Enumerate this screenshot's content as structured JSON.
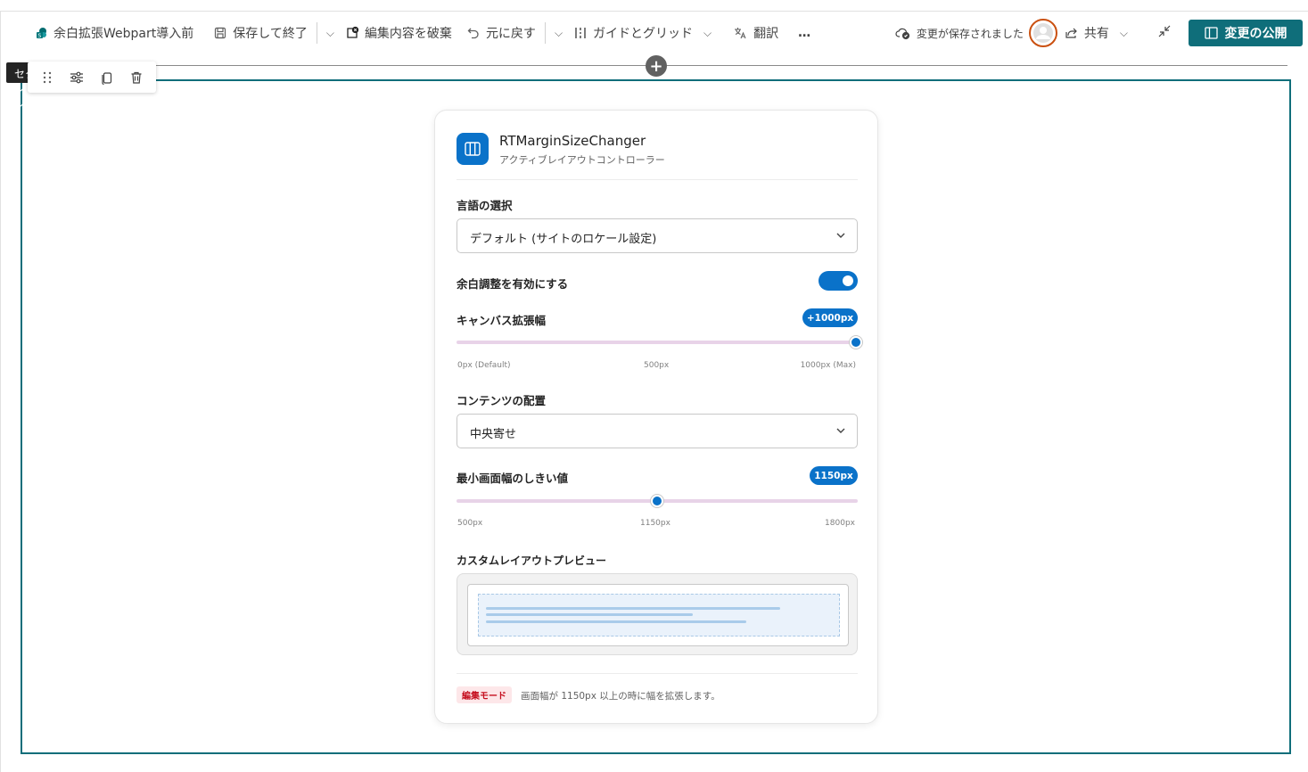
{
  "toolbar": {
    "page_name": "余白拡張Webpart導入前",
    "save_close": "保存して終了",
    "discard": "編集内容を破棄",
    "undo": "元に戻す",
    "guides": "ガイドとグリッド",
    "translate": "翻訳",
    "more": "…",
    "saved_status": "変更が保存されました",
    "share": "共有",
    "publish": "変更の公開",
    "accent_color": "#0f6e7a"
  },
  "section": {
    "tag_label": "セクション"
  },
  "card": {
    "title": "RTMarginSizeChanger",
    "subtitle": "アクティブレイアウトコントローラー",
    "language_label": "言語の選択",
    "language_value": "デフォルト (サイトのロケール設定)",
    "margin_toggle_label": "余白調整を有効にする",
    "margin_toggle_on": true,
    "canvas_label": "キャンバス拡張幅",
    "canvas_badge": "+1000px",
    "canvas_value_fraction": 1.0,
    "canvas_ticks": [
      "0px (Default)",
      "500px",
      "1000px (Max)"
    ],
    "alignment_label": "コンテンツの配置",
    "alignment_value": "中央寄せ",
    "threshold_label": "最小画面幅のしきい値",
    "threshold_badge": "1150px",
    "threshold_value_fraction": 0.5,
    "threshold_ticks": [
      "500px",
      "1150px",
      "1800px"
    ],
    "preview_label": "カスタムレイアウトプレビュー",
    "mode_badge": "編集モード",
    "footer_text": "画面幅が 1150px 以上の時に幅を拡張します。",
    "accent_color": "#0a72c9"
  }
}
